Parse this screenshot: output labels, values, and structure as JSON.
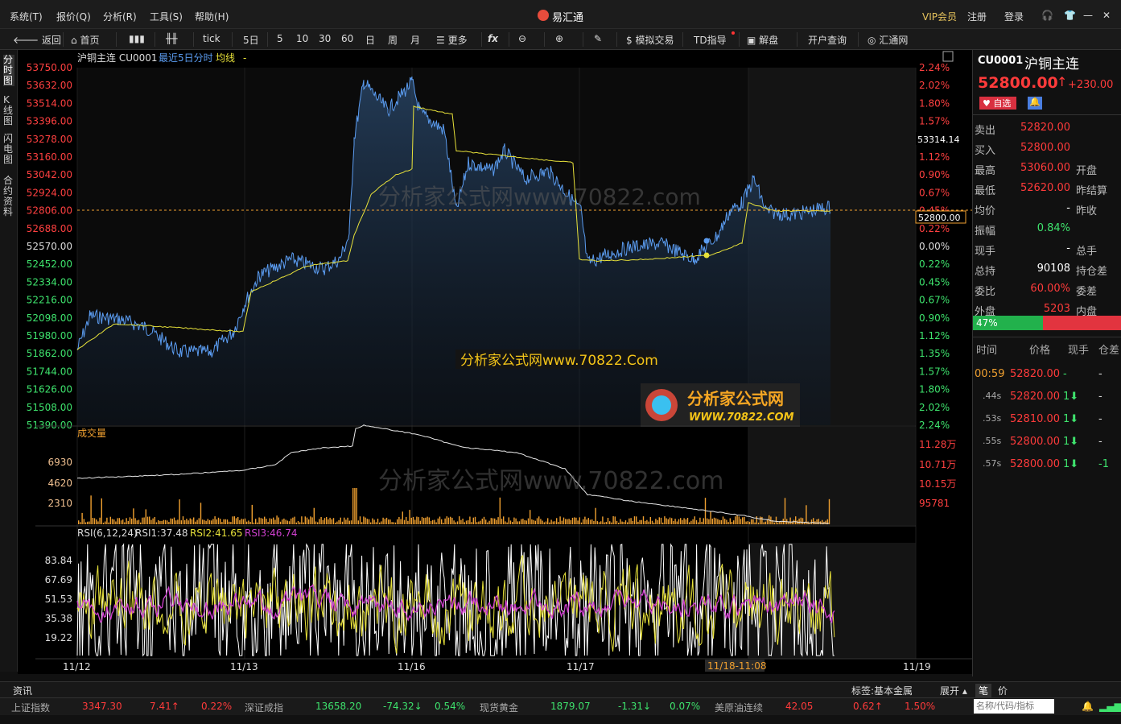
{
  "menu": [
    "系统(T)",
    "报价(Q)",
    "分析(R)",
    "工具(S)",
    "帮助(H)"
  ],
  "app_title": "易汇通",
  "topright": {
    "vip": "VIP会员",
    "register": "注册",
    "login": "登录"
  },
  "toolbar": {
    "back": "返回",
    "home": "首页",
    "tick": "tick",
    "d5": "5日",
    "m5": "5",
    "m10": "10",
    "m30": "30",
    "m60": "60",
    "day": "日",
    "week": "周",
    "month": "月",
    "more": "更多",
    "fx": "fx",
    "sim": "模拟交易",
    "td": "TD指导",
    "jiepan": "解盘",
    "open_account": "开户查询",
    "huitong": "汇通网"
  },
  "left_tabs": [
    "分时图",
    "K线图",
    "闪电图",
    "合约资料"
  ],
  "chart_header": {
    "name": "沪铜主连 CU0001",
    "mode": "最近5日分时",
    "avg": "均线",
    "dash": "-"
  },
  "price_axis_left": [
    "53750.00",
    "53632.00",
    "53514.00",
    "53396.00",
    "53278.00",
    "53160.00",
    "53042.00",
    "52924.00",
    "52806.00",
    "52688.00",
    "52570.00",
    "52452.00",
    "52334.00",
    "52216.00",
    "52098.00",
    "51980.00",
    "51862.00",
    "51744.00",
    "51626.00",
    "51508.00",
    "51390.00"
  ],
  "pct_axis_right": [
    "2.24%",
    "2.02%",
    "1.80%",
    "1.57%",
    "1.35%",
    "1.12%",
    "0.90%",
    "0.67%",
    "0.45%",
    "0.22%",
    "0.00%",
    "0.22%",
    "0.45%",
    "0.67%",
    "0.90%",
    "1.12%",
    "1.35%",
    "1.57%",
    "1.80%",
    "2.02%",
    "2.24%"
  ],
  "hover_price": "53314.14",
  "last_price_tag": "52800.00",
  "watermark": "分析家公式网www.70822.com",
  "watermark2": "分析家公式网www.70822.Com",
  "logo_text": "分析家公式网",
  "logo_url": "WWW.70822.COM",
  "volume": {
    "title": "成交量",
    "left": [
      "6930",
      "4620",
      "2310"
    ],
    "right": [
      "11.28万",
      "10.71万",
      "10.15万",
      "95781"
    ]
  },
  "rsi": {
    "title": "RSI(6,12,24)",
    "rsi1": "RSI1:37.48",
    "rsi2": "RSI2:41.65",
    "rsi3": "RSI3:46.74",
    "axis": [
      "83.84",
      "67.69",
      "51.53",
      "35.38",
      "19.22"
    ]
  },
  "dates": [
    "11/12",
    "11/13",
    "11/16",
    "11/17",
    "11/18-11:08",
    "11/19"
  ],
  "right_panel": {
    "code": "CU0001",
    "name": "沪铜主连",
    "price": "52800.00",
    "arrow": "↑",
    "change": "+230.00",
    "fav": "自选",
    "rows": [
      {
        "l": "卖出",
        "v": "52820.00",
        "c": "red",
        "l2": ""
      },
      {
        "l": "买入",
        "v": "52800.00",
        "c": "red",
        "l2": ""
      },
      {
        "l": "最高",
        "v": "53060.00",
        "c": "red",
        "l2": "开盘"
      },
      {
        "l": "最低",
        "v": "52620.00",
        "c": "red",
        "l2": "昨结算"
      },
      {
        "l": "均价",
        "v": "-",
        "c": "white",
        "l2": "昨收"
      },
      {
        "l": "振幅",
        "v": "0.84%",
        "c": "green",
        "l2": ""
      },
      {
        "l": "现手",
        "v": "-",
        "c": "white",
        "l2": "总手"
      },
      {
        "l": "总持",
        "v": "90108",
        "c": "white",
        "l2": "持仓差"
      },
      {
        "l": "委比",
        "v": "60.00%",
        "c": "red",
        "l2": "委差"
      },
      {
        "l": "外盘",
        "v": "5203",
        "c": "red",
        "l2": "内盘"
      }
    ],
    "ratio": "47%",
    "ratio_value": 47,
    "ticks_header": [
      "时间",
      "价格",
      "现手",
      "仓差"
    ],
    "ticks": [
      {
        "t": "00:59",
        "p": "52820.00",
        "q": "-",
        "d": "-"
      },
      {
        "t": ".44s",
        "p": "52820.00",
        "q": "1",
        "d": "-"
      },
      {
        "t": ".53s",
        "p": "52810.00",
        "q": "1",
        "d": "-"
      },
      {
        "t": ".55s",
        "p": "52800.00",
        "q": "1",
        "d": "-"
      },
      {
        "t": ".57s",
        "p": "52800.00",
        "q": "1",
        "d": "-1"
      }
    ],
    "tabs": [
      "笔",
      "价"
    ]
  },
  "infobar": {
    "news": "资讯",
    "tag": "标签:基本金属",
    "expand": "展开"
  },
  "ticker": [
    {
      "n": "上证指数",
      "v": "3347.30",
      "c": "7.41↑",
      "p": "0.22%",
      "col": "red"
    },
    {
      "n": "深证成指",
      "v": "13658.20",
      "c": "-74.32↓",
      "p": "0.54%",
      "col": "green"
    },
    {
      "n": "现货黄金",
      "v": "1879.07",
      "c": "-1.31↓",
      "p": "0.07%",
      "col": "green"
    },
    {
      "n": "美原油连续",
      "v": "42.05",
      "c": "0.62↑",
      "p": "1.50%",
      "col": "red"
    }
  ],
  "search_placeholder": "名称/代码/指标"
}
